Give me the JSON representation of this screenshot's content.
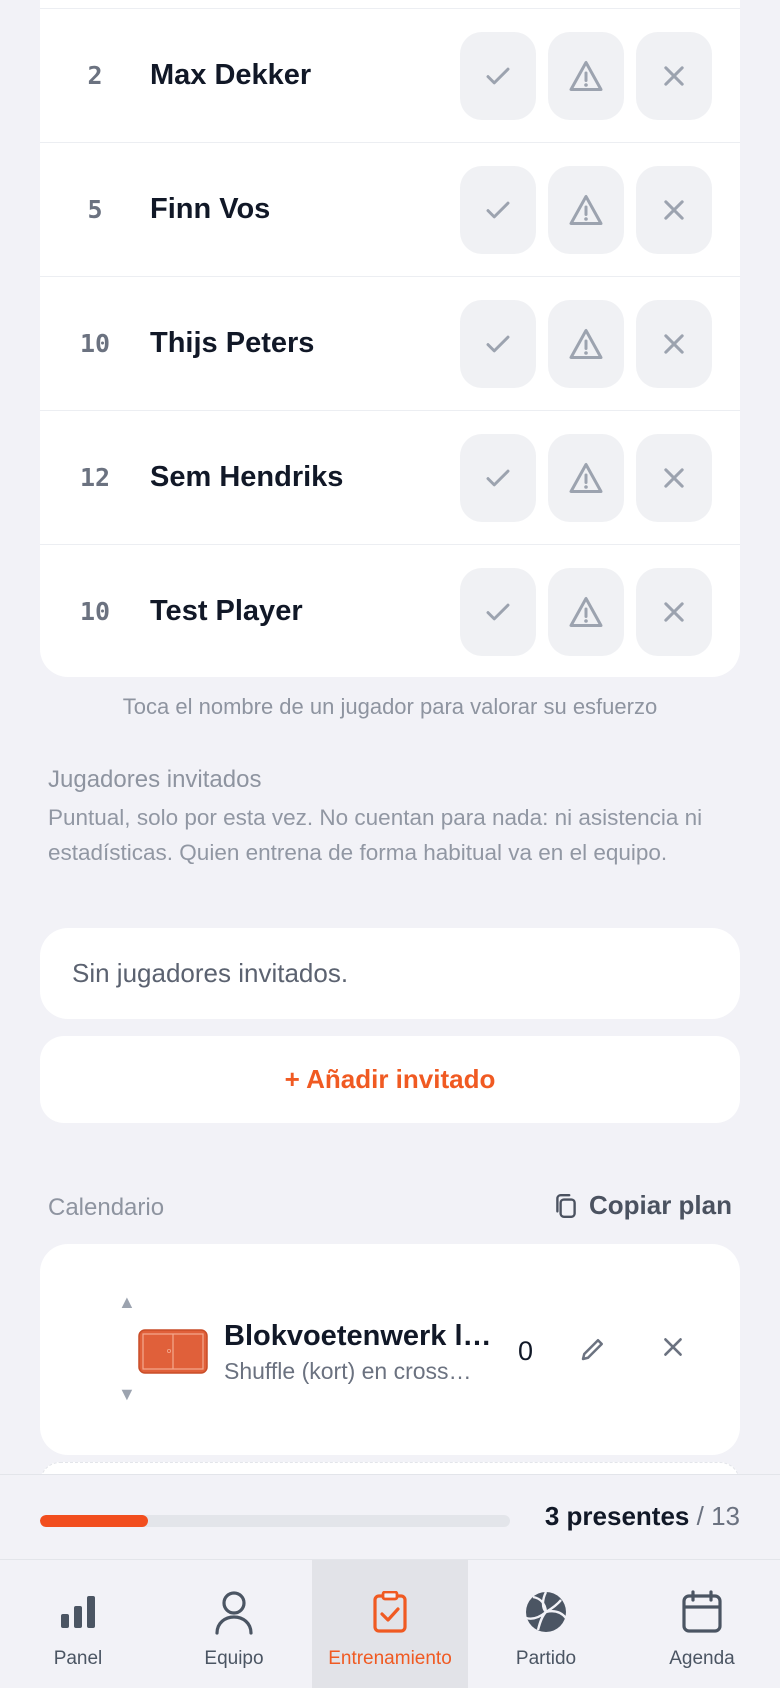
{
  "players": [
    {
      "number": "2",
      "name": "Max Dekker"
    },
    {
      "number": "5",
      "name": "Finn Vos"
    },
    {
      "number": "10",
      "name": "Thijs Peters"
    },
    {
      "number": "12",
      "name": "Sem Hendriks"
    },
    {
      "number": "10",
      "name": "Test Player"
    }
  ],
  "status_buttons": [
    "check-icon",
    "warning-icon",
    "close-icon"
  ],
  "hint": "Toca el nombre de un jugador para valorar su esfuerzo",
  "guests": {
    "title": "Jugadores invitados",
    "description": "Puntual, solo por esta vez. No cuentan para nada: ni asistencia ni estadísticas. Quien entrena de forma habitual va en el equipo.",
    "empty_text": "Sin jugadores invitados.",
    "add_label": "+ Añadir invitado"
  },
  "schedule": {
    "title": "Calendario",
    "copy_label": "Copiar plan",
    "drills": [
      {
        "title": "Blokvoetenwerk la…",
        "subtitle": "Shuffle (kort) en cross…",
        "count": "0"
      }
    ]
  },
  "attendance": {
    "present_label": "3 presentes",
    "total_label": "/ 13",
    "present": 3,
    "total": 13
  },
  "nav": {
    "items": [
      {
        "label": "Panel",
        "icon": "bar-chart-icon"
      },
      {
        "label": "Equipo",
        "icon": "user-icon"
      },
      {
        "label": "Entrenamiento",
        "icon": "clipboard-check-icon",
        "active": true
      },
      {
        "label": "Partido",
        "icon": "volleyball-icon"
      },
      {
        "label": "Agenda",
        "icon": "calendar-icon"
      }
    ]
  },
  "colors": {
    "accent": "#f05a22",
    "muted_icon": "#9ca3af"
  }
}
